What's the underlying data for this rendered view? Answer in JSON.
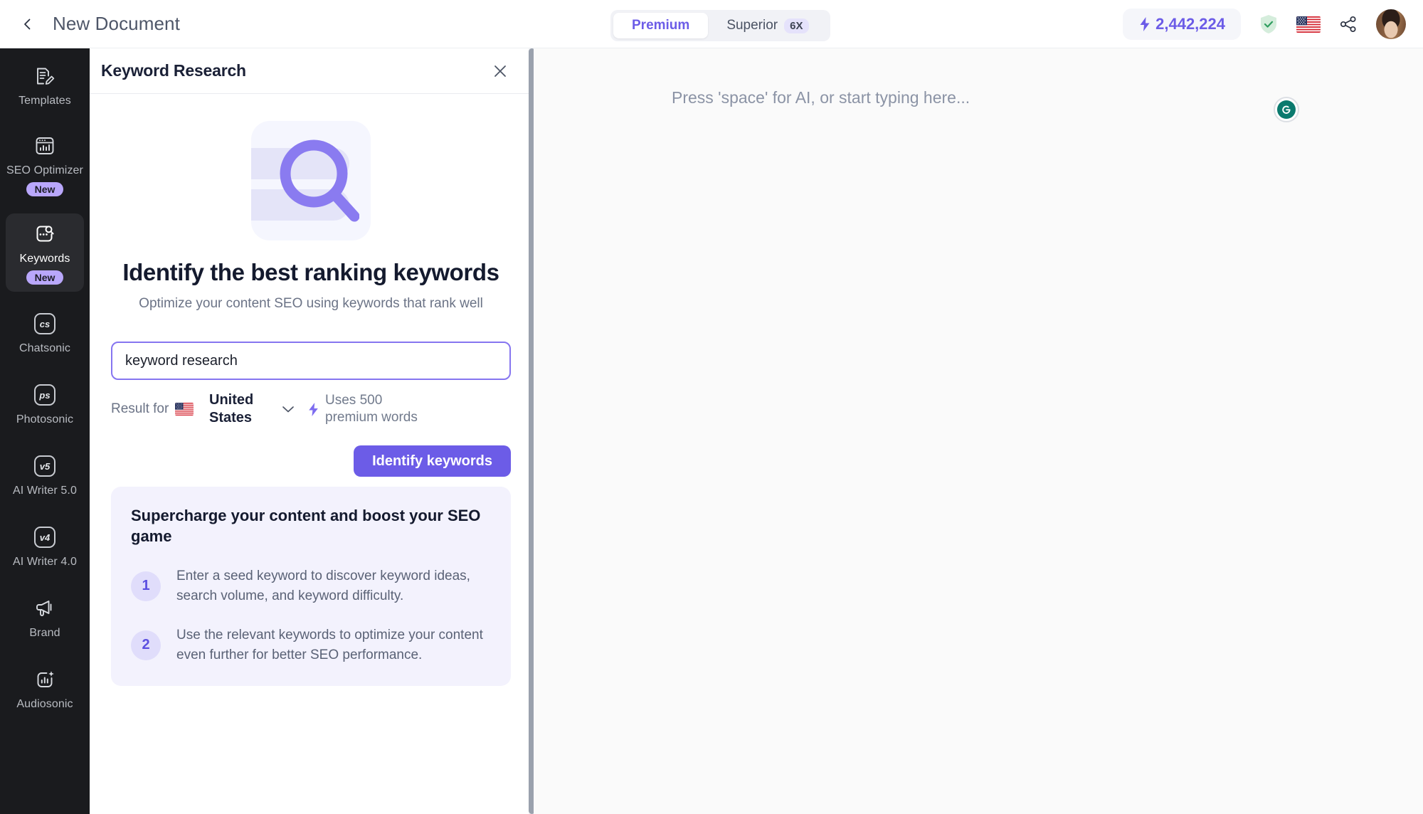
{
  "header": {
    "back_icon": "chevron-left-icon",
    "document_title": "New Document",
    "mode_toggle": {
      "options": [
        {
          "label": "Premium",
          "badge": "",
          "active": true
        },
        {
          "label": "Superior",
          "badge": "6X",
          "active": false
        }
      ]
    },
    "credits": {
      "icon": "lightning-bolt-icon",
      "value": "2,442,224"
    },
    "shield_icon": "shield-check-icon",
    "language_flag": "us-flag-icon",
    "share_icon": "share-icon",
    "avatar": "user-avatar"
  },
  "sidebar": {
    "items": [
      {
        "label": "Templates",
        "icon": "document-edit-icon",
        "badge": "",
        "active": false
      },
      {
        "label": "SEO Optimizer",
        "icon": "seo-chart-window-icon",
        "badge": "New",
        "active": false
      },
      {
        "label": "Keywords",
        "icon": "keywords-search-icon",
        "badge": "New",
        "active": true
      },
      {
        "label": "Chatsonic",
        "icon": "cs-square-icon",
        "glyph": "cs",
        "badge": "",
        "active": false
      },
      {
        "label": "Photosonic",
        "icon": "ps-square-icon",
        "glyph": "ps",
        "badge": "",
        "active": false
      },
      {
        "label": "AI Writer 5.0",
        "icon": "v5-square-icon",
        "glyph": "v5",
        "badge": "",
        "active": false
      },
      {
        "label": "AI Writer 4.0",
        "icon": "v4-square-icon",
        "glyph": "v4",
        "badge": "",
        "active": false
      },
      {
        "label": "Brand",
        "icon": "megaphone-icon",
        "badge": "",
        "active": false
      },
      {
        "label": "Audiosonic",
        "icon": "audio-bars-sparkle-icon",
        "badge": "",
        "active": false
      }
    ]
  },
  "panel": {
    "title": "Keyword Research",
    "close_icon": "close-icon",
    "illustration": "magnifier-search-illustration",
    "hero_title": "Identify the best ranking keywords",
    "hero_subtitle": "Optimize your content SEO using keywords that rank well",
    "keyword_input": {
      "value": "keyword research",
      "placeholder": "Enter a keyword"
    },
    "result_for_label": "Result for",
    "country": {
      "flag": "us-flag-icon",
      "name": "United States",
      "chevron": "chevron-down-icon"
    },
    "premium_note": {
      "icon": "lightning-bolt-icon",
      "text": "Uses 500 premium words"
    },
    "submit_label": "Identify keywords",
    "tips": {
      "title": "Supercharge your content and boost your SEO game",
      "items": [
        {
          "num": "1",
          "text": "Enter a seed keyword to discover keyword ideas, search volume, and keyword difficulty."
        },
        {
          "num": "2",
          "text": "Use the relevant keywords to optimize your content even further for better SEO performance."
        }
      ]
    }
  },
  "editor": {
    "placeholder": "Press 'space' for AI, or start typing here...",
    "grammarly_icon": "grammarly-icon",
    "grammarly_glyph": "G"
  },
  "colors": {
    "accent": "#6c5ce7",
    "accent_light": "#8675f0",
    "badge_bg": "#b9a7fb",
    "tips_bg": "#f3f2fd",
    "rail_bg": "#1a1b1e",
    "rail_active": "#2a2b2f",
    "grammarly_green": "#0b7a6e"
  }
}
